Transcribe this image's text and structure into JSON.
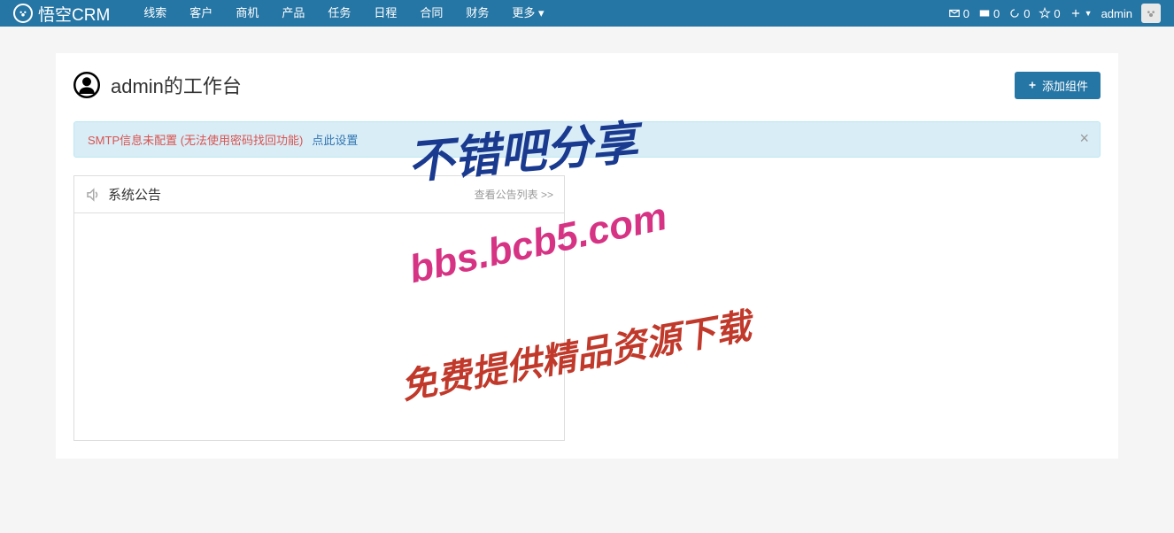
{
  "brand": {
    "name": "悟空CRM"
  },
  "nav": {
    "items": [
      "线索",
      "客户",
      "商机",
      "产品",
      "任务",
      "日程",
      "合同",
      "财务",
      "更多 ▾"
    ]
  },
  "navRight": {
    "mail": "0",
    "contacts": "0",
    "refresh": "0",
    "star": "0",
    "username": "admin"
  },
  "page": {
    "title": "admin的工作台",
    "addButton": "添加组件"
  },
  "alert": {
    "text": "SMTP信息未配置 (无法使用密码找回功能)",
    "link": "点此设置"
  },
  "widget": {
    "title": "系统公告",
    "link": "查看公告列表 >>"
  },
  "watermark": {
    "line1": "不错吧分享",
    "line2": "bbs.bcb5.com",
    "line3": "免费提供精品资源下载"
  }
}
